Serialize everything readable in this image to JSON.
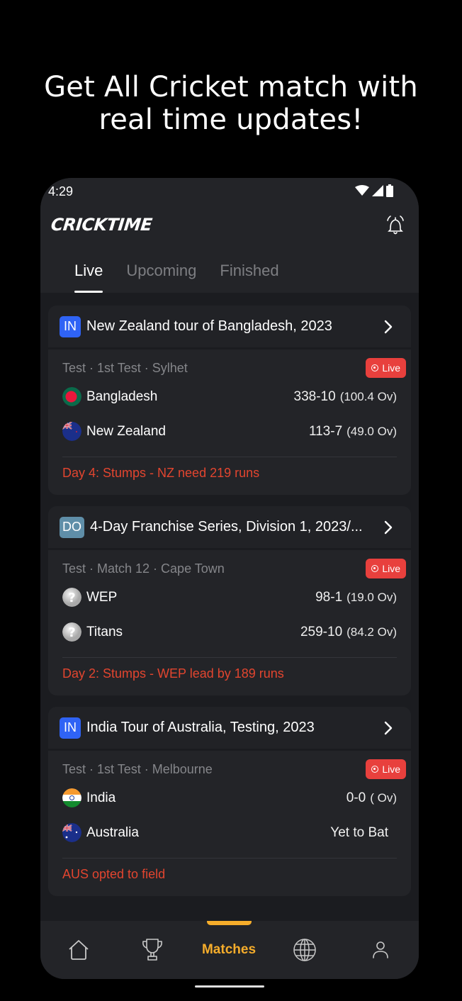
{
  "promo": {
    "line1": "Get All Cricket match with",
    "line2": "real time updates!"
  },
  "status_bar": {
    "time": "4:29",
    "icons": [
      "wifi-icon",
      "signal-icon",
      "battery-icon"
    ]
  },
  "app": {
    "logo": "CRICKTIME",
    "bell_icon": "bell-ringing-icon"
  },
  "tabs": [
    {
      "label": "Live",
      "active": true
    },
    {
      "label": "Upcoming",
      "active": false
    },
    {
      "label": "Finished",
      "active": false
    }
  ],
  "colors": {
    "accent": "#f6ad2b",
    "live": "#e8403d",
    "result": "#e2452f",
    "badge_in": "#2f63f5",
    "badge_do": "#5f8ea8"
  },
  "matches": [
    {
      "badge": "IN",
      "series": "New Zealand tour of Bangladesh, 2023",
      "meta": "Test · 1st Test · Sylhet",
      "live_label": "Live",
      "teams": [
        {
          "name": "Bangladesh",
          "flag": "bangladesh",
          "score": "338-10",
          "overs": "(100.4 Ov)"
        },
        {
          "name": "New Zealand",
          "flag": "new-zealand",
          "score": "113-7",
          "overs": "(49.0 Ov)"
        }
      ],
      "result": "Day 4: Stumps - NZ need 219 runs"
    },
    {
      "badge": "DO",
      "series": "4-Day Franchise Series, Division 1, 2023/...",
      "meta": "Test · Match 12 · Cape Town",
      "live_label": "Live",
      "teams": [
        {
          "name": "WEP",
          "flag": "unknown",
          "score": "98-1",
          "overs": "(19.0 Ov)"
        },
        {
          "name": "Titans",
          "flag": "unknown",
          "score": "259-10",
          "overs": "(84.2 Ov)"
        }
      ],
      "result": "Day 2: Stumps - WEP lead by 189 runs"
    },
    {
      "badge": "IN",
      "series": "India Tour of Australia, Testing, 2023",
      "meta": "Test · 1st Test · Melbourne",
      "live_label": "Live",
      "teams": [
        {
          "name": "India",
          "flag": "india",
          "score": "0-0",
          "overs": "( Ov)"
        },
        {
          "name": "Australia",
          "flag": "australia",
          "score": "Yet to Bat",
          "overs": ""
        }
      ],
      "result": "AUS opted to field"
    }
  ],
  "bottom_nav": [
    {
      "icon": "home-icon",
      "label": "Home",
      "active": false
    },
    {
      "icon": "trophy-icon",
      "label": "Series",
      "active": false
    },
    {
      "icon": "",
      "label": "Matches",
      "active": true
    },
    {
      "icon": "globe-icon",
      "label": "Rankings",
      "active": false
    },
    {
      "icon": "user-icon",
      "label": "Profile",
      "active": false
    }
  ]
}
